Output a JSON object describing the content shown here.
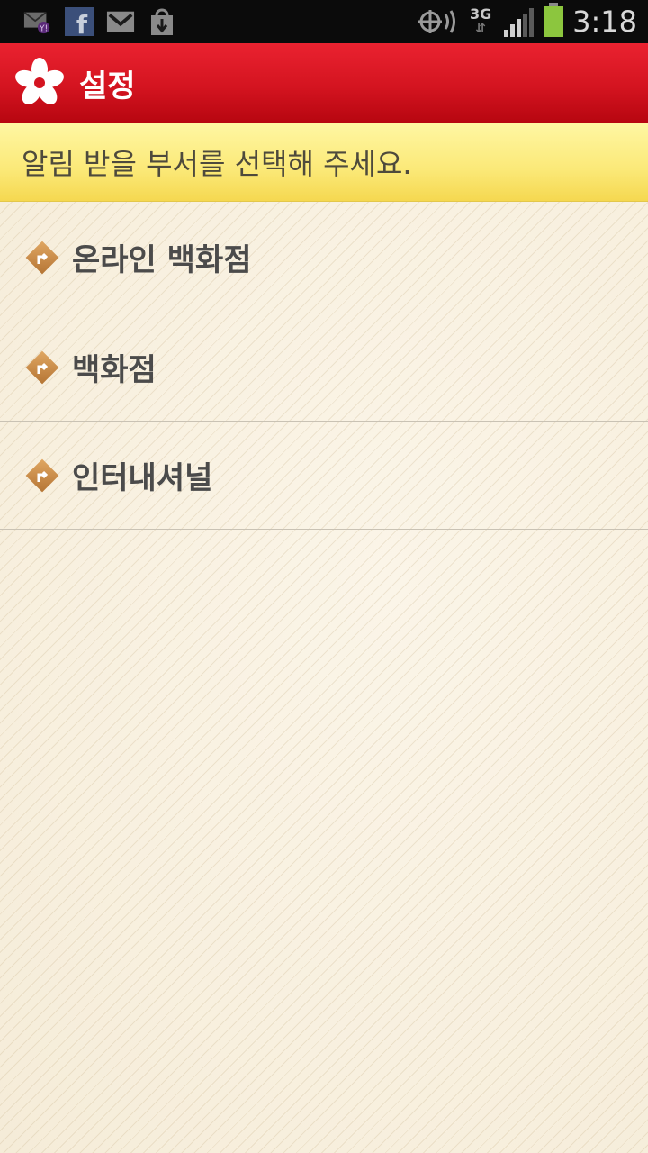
{
  "status_bar": {
    "time": "3:18",
    "network": "3G",
    "notification_icons": [
      "yahoo-mail-icon",
      "facebook-icon",
      "gmail-icon",
      "download-icon"
    ],
    "status_icons": [
      "gps-icon",
      "3g-icon",
      "signal-icon",
      "battery-icon"
    ]
  },
  "app_bar": {
    "title": "설정",
    "color": "#d41420"
  },
  "notice": {
    "text": "알림 받을 부서를 선택해 주세요.",
    "color": "#fbe978"
  },
  "departments": [
    {
      "label": "온라인 백화점"
    },
    {
      "label": "백화점"
    },
    {
      "label": "인터내셔널"
    }
  ],
  "colors": {
    "accent_icon": "#c98a45",
    "list_text": "#4b4b4b",
    "divider": "#c9c2b4"
  }
}
